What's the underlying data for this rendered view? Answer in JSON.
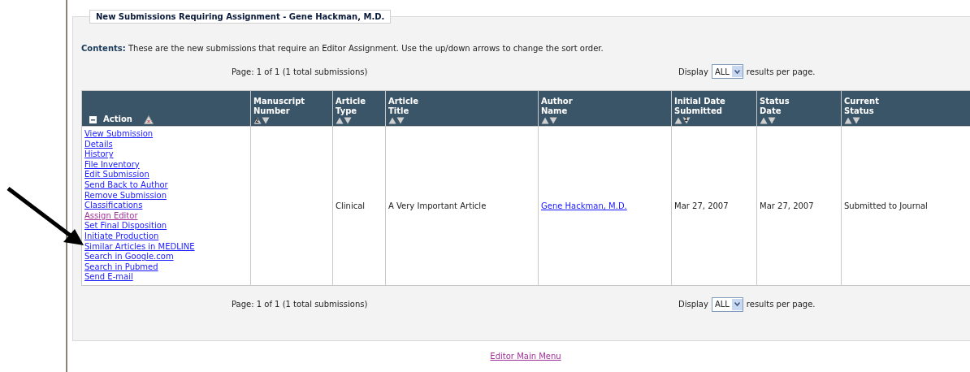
{
  "panel": {
    "title": "New Submissions Requiring Assignment - Gene Hackman, M.D.",
    "contents_label": "Contents:",
    "contents_text": "These are the new submissions that require an Editor Assignment. Use the up/down arrows to change the sort order."
  },
  "pager_top": {
    "page": "Page: 1 of 1 (1 total submissions)",
    "display_label": "Display",
    "per_page": "ALL",
    "suffix": "results per page."
  },
  "table": {
    "columns": [
      {
        "label": [
          "Action"
        ],
        "kind": "action"
      },
      {
        "label": [
          "Manuscript",
          "Number"
        ],
        "kind": "sort",
        "up_rank": "2"
      },
      {
        "label": [
          "Article",
          "Type"
        ],
        "kind": "sort"
      },
      {
        "label": [
          "Article",
          "Title"
        ],
        "kind": "sort"
      },
      {
        "label": [
          "Author",
          "Name"
        ],
        "kind": "sort"
      },
      {
        "label": [
          "Initial Date",
          "Submitted"
        ],
        "kind": "sort",
        "down_rank": "1"
      },
      {
        "label": [
          "Status",
          "Date"
        ],
        "kind": "sort"
      },
      {
        "label": [
          "Current",
          "Status"
        ],
        "kind": "sort"
      }
    ],
    "rows": [
      {
        "cells": [
          {
            "kind": "actions",
            "links": [
              {
                "label": "View Submission",
                "visited": false
              },
              {
                "label": "Details",
                "visited": false
              },
              {
                "label": "History",
                "visited": false
              },
              {
                "label": "File Inventory",
                "visited": false
              },
              {
                "label": "Edit Submission",
                "visited": false
              },
              {
                "label": "Send Back to Author",
                "visited": false
              },
              {
                "label": "Remove Submission",
                "visited": false
              },
              {
                "label": "Classifications",
                "visited": false
              },
              {
                "label": "Assign Editor",
                "visited": true
              },
              {
                "label": "Set Final Disposition",
                "visited": false
              },
              {
                "label": "Initiate Production",
                "visited": false
              },
              {
                "label": "Similar Articles in MEDLINE",
                "visited": false
              },
              {
                "label": "Search in Google.com",
                "visited": false
              },
              {
                "label": "Search in Pubmed",
                "visited": false
              },
              {
                "label": "Send E-mail",
                "visited": false
              }
            ]
          },
          {
            "text": ""
          },
          {
            "text": "Clinical"
          },
          {
            "text": "A Very Important Article"
          },
          {
            "text": "Gene Hackman, M.D.",
            "kind": "link"
          },
          {
            "text": "Mar 27, 2007"
          },
          {
            "text": "Mar 27, 2007"
          },
          {
            "text": "Submitted to Journal"
          }
        ]
      }
    ]
  },
  "pager_bottom": {
    "page": "Page: 1 of 1 (1 total submissions)",
    "display_label": "Display",
    "per_page": "ALL",
    "suffix": "results per page."
  },
  "footer_link": {
    "label": "Editor Main Menu",
    "visited": true
  }
}
